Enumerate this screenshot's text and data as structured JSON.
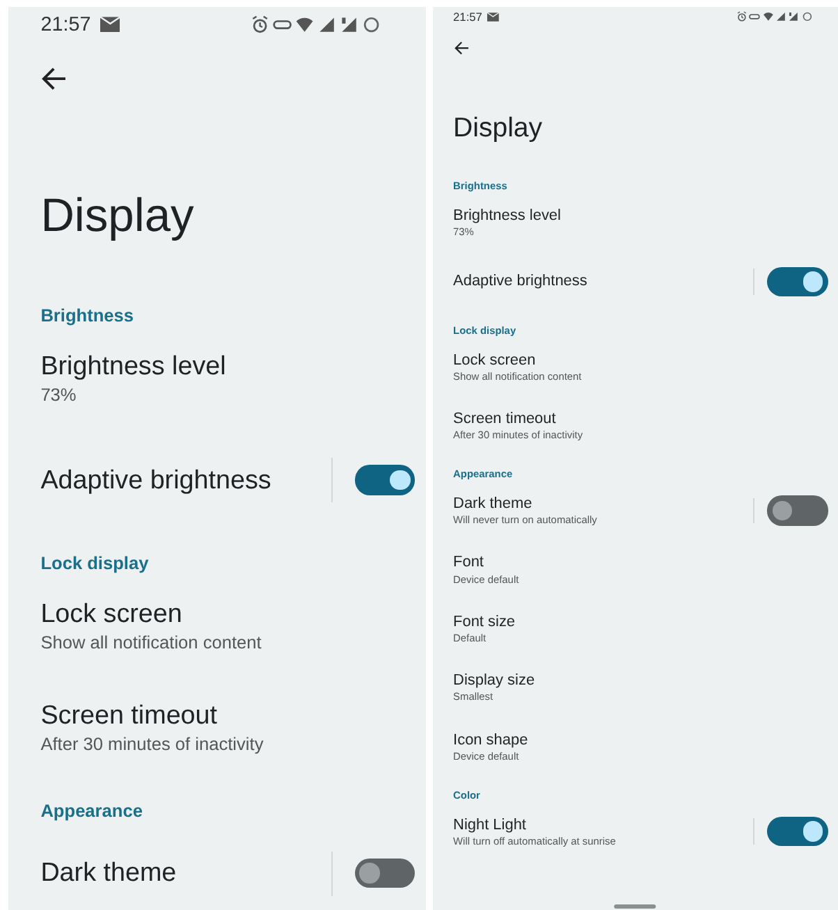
{
  "screens": [
    {
      "status_bar": {
        "time": "21:57"
      },
      "title": "Display",
      "sections": [
        {
          "header": "Brightness",
          "items": [
            {
              "kind": "plain",
              "title": "Brightness level",
              "summary": "73%"
            },
            {
              "kind": "switch",
              "title": "Adaptive brightness",
              "on": true
            }
          ]
        },
        {
          "header": "Lock display",
          "items": [
            {
              "kind": "plain",
              "title": "Lock screen",
              "summary": "Show all notification content"
            },
            {
              "kind": "plain",
              "title": "Screen timeout",
              "summary": "After 30 minutes of inactivity"
            }
          ]
        },
        {
          "header": "Appearance",
          "items": [
            {
              "kind": "switch",
              "title": "Dark theme",
              "on": false
            }
          ]
        }
      ]
    },
    {
      "status_bar": {
        "time": "21:57"
      },
      "title": "Display",
      "nav_handle": true,
      "sections": [
        {
          "header": "Brightness",
          "items": [
            {
              "kind": "plain",
              "title": "Brightness level",
              "summary": "73%"
            },
            {
              "kind": "switch",
              "title": "Adaptive brightness",
              "on": true
            }
          ]
        },
        {
          "header": "Lock display",
          "items": [
            {
              "kind": "plain",
              "title": "Lock screen",
              "summary": "Show all notification content"
            },
            {
              "kind": "plain",
              "title": "Screen timeout",
              "summary": "After 30 minutes of inactivity"
            }
          ]
        },
        {
          "header": "Appearance",
          "items": [
            {
              "kind": "switch",
              "title": "Dark theme",
              "summary": "Will never turn on automatically",
              "on": false
            },
            {
              "kind": "plain",
              "title": "Font",
              "summary": "Device default"
            },
            {
              "kind": "plain",
              "title": "Font size",
              "summary": "Default"
            },
            {
              "kind": "plain",
              "title": "Display size",
              "summary": "Smallest"
            },
            {
              "kind": "plain",
              "title": "Icon shape",
              "summary": "Device default"
            }
          ]
        },
        {
          "header": "Color",
          "items": [
            {
              "kind": "switch",
              "title": "Night Light",
              "summary": "Will turn off automatically at sunrise",
              "on": true
            }
          ]
        }
      ]
    }
  ]
}
